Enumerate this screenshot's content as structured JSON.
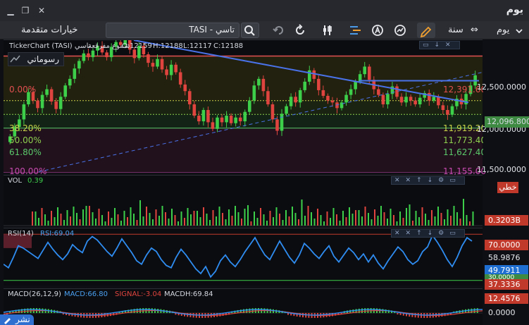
{
  "window": {
    "title": "يوم"
  },
  "toolbar": {
    "period_day": "يوم",
    "period_year": "سنة",
    "advanced_options": "خيارات متقدمة",
    "search_value": "TASI - تاسي"
  },
  "price_panel": {
    "header_ticker": "TickerChart (TASI) تاسي",
    "header_type": "شموع مفرقعة",
    "open": "O:12159",
    "high": "H:12188",
    "low": "L:12117",
    "close": "C:12188",
    "drawings_label": "رسوماتي",
    "fib_levels": [
      {
        "pct": "0.00%",
        "value": "12,391.60",
        "color": "#e25050"
      },
      {
        "pct": "38.20%",
        "value": "11,919.20",
        "color": "#c8d34a"
      },
      {
        "pct": "50.00%",
        "value": "11,773.40",
        "color": "#8fd14f"
      },
      {
        "pct": "61.80%",
        "value": "11,627.40",
        "color": "#5bc96a"
      },
      {
        "pct": "100.00%",
        "value": "11,155.00",
        "color": "#c84ab0"
      }
    ],
    "axis_ticks": [
      "12,500.0000",
      "12,000.0000",
      "11,500.0000"
    ],
    "last_price": "12,096.8000",
    "last_price_color": "#ffffff",
    "mode_badge": "خطي",
    "mode_badge_color": "#c0392b",
    "colors": {
      "up": "#3ecf4a",
      "down": "#e0443e",
      "trendline": "#4a72e8"
    }
  },
  "chart_data": [
    {
      "type": "candlestick",
      "title": "TickerChart (TASI) تاسي",
      "ylim": [
        11155,
        12560
      ],
      "series": [
        {
          "name": "TASI",
          "close": [
            11540,
            11640,
            11720,
            11880,
            12010,
            11920,
            11840,
            11980,
            12040,
            11910,
            11830,
            11960,
            12080,
            12150,
            12260,
            12340,
            12420,
            12380,
            12450,
            12500,
            12430,
            12380,
            12490,
            12540,
            12510,
            12580,
            12460,
            12370,
            12500,
            12410,
            12320,
            12280,
            12360,
            12250,
            12190,
            12300,
            12220,
            12090,
            12020,
            11880,
            11760,
            11700,
            11820,
            11690,
            11620,
            11740,
            11690,
            11760,
            11680,
            11740,
            11700,
            11800,
            11920,
            12080,
            12150,
            12020,
            11880,
            11720,
            11600,
            11780,
            11860,
            11960,
            11900,
            12030,
            12120,
            12240,
            12150,
            12030,
            11970,
            11920,
            11900,
            11840,
            11900,
            11980,
            12040,
            12120,
            12200,
            12280,
            12140,
            12040,
            11980,
            11880,
            11990,
            12070,
            11960,
            11900,
            11960,
            11920,
            11880,
            11950,
            12000,
            11920,
            11960,
            11870,
            11820,
            11770,
            11860,
            11940,
            11880,
            11990,
            12080,
            12188
          ]
        }
      ]
    },
    {
      "type": "bar",
      "title": "VOL",
      "series": [
        {
          "name": "VOL",
          "last": "0.39",
          "axis_value": "0.3203B"
        }
      ]
    },
    {
      "type": "line",
      "title": "RSI(14)",
      "series": [
        {
          "name": "RSI",
          "last": "RSI:69.04",
          "values": [
            44,
            41,
            50,
            60,
            58,
            55,
            52,
            49,
            56,
            63,
            57,
            52,
            48,
            53,
            61,
            57,
            54,
            64,
            68,
            65,
            60,
            55,
            51,
            58,
            66,
            60,
            54,
            47,
            44,
            52,
            58,
            55,
            48,
            43,
            41,
            50,
            57,
            52,
            46,
            40,
            36,
            42,
            33,
            38,
            47,
            52,
            46,
            42,
            48,
            55,
            61,
            67,
            59,
            52,
            48,
            56,
            64,
            57,
            50,
            45,
            52,
            62,
            58,
            53,
            49,
            55,
            60,
            51,
            46,
            52,
            58,
            54,
            48,
            53,
            46,
            52,
            45,
            40,
            47,
            53,
            59,
            55,
            48,
            44,
            47,
            55,
            59,
            69,
            63,
            56,
            48,
            42,
            50,
            60,
            67,
            64
          ]
        }
      ],
      "levels": [
        "70.0000",
        "30.0000"
      ],
      "axis_values": [
        "58.9876",
        "49.7911",
        "37.3336"
      ]
    },
    {
      "type": "line",
      "title": "MACD(26,12,9)",
      "series": [
        {
          "name": "MACD",
          "last": "MACD:66.80"
        },
        {
          "name": "SIGNAL",
          "last": "SIGNAL:-3.04"
        },
        {
          "name": "MACDH",
          "last": "MACDH:69.84"
        }
      ],
      "axis_values": [
        "12.4576",
        "0.0000"
      ]
    }
  ],
  "bottom": {
    "publish_label": "نشر"
  }
}
